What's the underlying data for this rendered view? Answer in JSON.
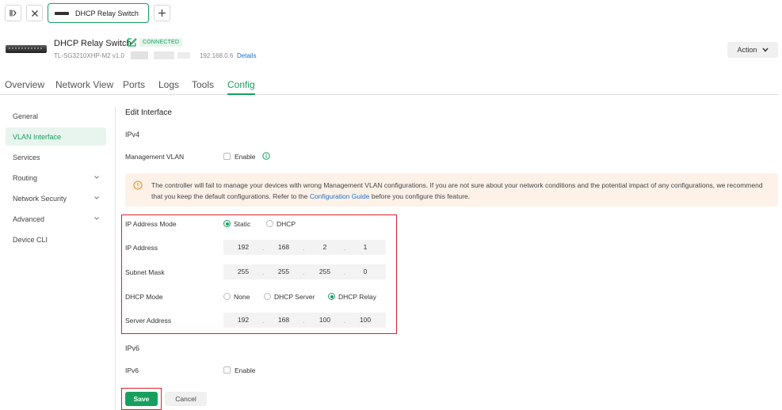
{
  "tabbar": {
    "tab_title": "DHCP Relay Switch"
  },
  "device": {
    "name": "DHCP Relay Switch",
    "status": "CONNECTED",
    "model": "TL-SG3210XHP-M2 v1.0",
    "ip": "192.168.0.6",
    "details_link": "Details",
    "action_label": "Action"
  },
  "nav_tabs": [
    "Overview",
    "Network View",
    "Ports",
    "Logs",
    "Tools",
    "Config"
  ],
  "active_tab": "Config",
  "sidebar": {
    "items": [
      {
        "label": "General",
        "expandable": false
      },
      {
        "label": "VLAN Interface",
        "expandable": false,
        "active": true
      },
      {
        "label": "Services",
        "expandable": false
      },
      {
        "label": "Routing",
        "expandable": true
      },
      {
        "label": "Network Security",
        "expandable": true
      },
      {
        "label": "Advanced",
        "expandable": true
      },
      {
        "label": "Device CLI",
        "expandable": false
      }
    ]
  },
  "form": {
    "title": "Edit Interface",
    "ipv4_section": "IPv4",
    "mgmt_vlan_label": "Management VLAN",
    "mgmt_vlan_enable": "Enable",
    "warning": {
      "text_before": "The controller will fail to manage your devices with wrong Management VLAN configurations. If you are not sure about your network conditions and the potential impact of any configurations, we recommend that you keep the default configurations. Refer to the ",
      "link": "Configuration Guide",
      "text_after": " before you configure this feature."
    },
    "ip_mode": {
      "label": "IP Address Mode",
      "options": [
        "Static",
        "DHCP"
      ],
      "selected": "Static"
    },
    "ip_address": {
      "label": "IP Address",
      "octets": [
        "192",
        "168",
        "2",
        "1"
      ]
    },
    "subnet_mask": {
      "label": "Subnet Mask",
      "octets": [
        "255",
        "255",
        "255",
        "0"
      ]
    },
    "dhcp_mode": {
      "label": "DHCP Mode",
      "options": [
        "None",
        "DHCP Server",
        "DHCP Relay"
      ],
      "selected": "DHCP Relay"
    },
    "server_address": {
      "label": "Server Address",
      "octets": [
        "192",
        "168",
        "100",
        "100"
      ]
    },
    "ipv6_section": "IPv6",
    "ipv6_label": "IPv6",
    "ipv6_enable": "Enable",
    "save_label": "Save",
    "cancel_label": "Cancel"
  },
  "colors": {
    "accent": "#17a05d",
    "highlight_box": "#d9232e",
    "link": "#1a73c8",
    "warning_bg": "#fdf1e8"
  }
}
